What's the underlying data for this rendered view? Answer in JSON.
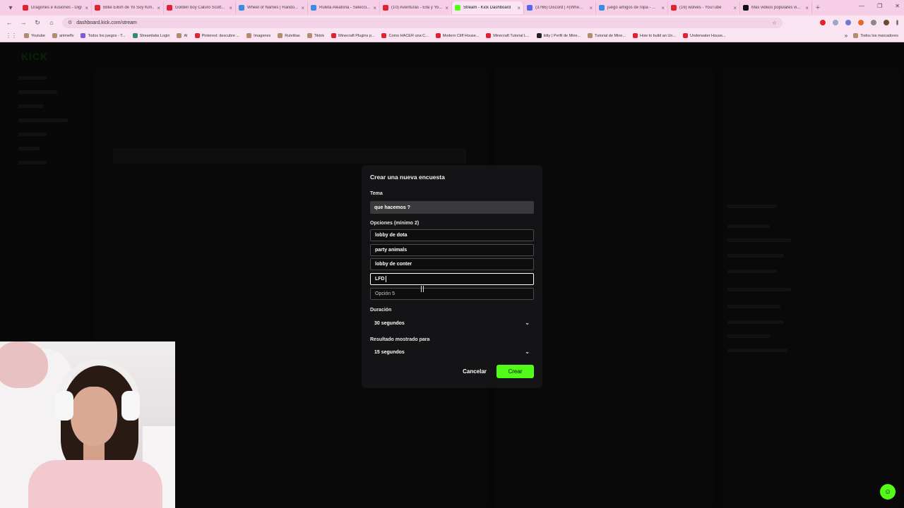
{
  "browser": {
    "tabs": [
      {
        "title": "Dragones e ilusiones - Digital...",
        "color": "#e0242f",
        "active": false
      },
      {
        "title": "Billie Eilish de Yo Soy Kim...",
        "color": "#e0242f",
        "active": false
      },
      {
        "title": "Golden boy Caluro Scott...",
        "color": "#e0242f",
        "active": false
      },
      {
        "title": "Wheel of Names | Rando...",
        "color": "#3b8be3",
        "active": false
      },
      {
        "title": "Ruleta Aleatoria - Selecci...",
        "color": "#3b8be3",
        "active": false
      },
      {
        "title": "(10) Aventuras - Ella y Yo...",
        "color": "#e0242f",
        "active": false
      },
      {
        "title": "Stream - Kick Dashboard",
        "color": "#53fc18",
        "active": true
      },
      {
        "title": "(3766) Discord | #(Whe...",
        "color": "#5865f2",
        "active": false
      },
      {
        "title": "juego amigos de ropa - ...",
        "color": "#3b8be3",
        "active": false
      },
      {
        "title": "(16) wolves - YouTube",
        "color": "#e0242f",
        "active": false
      },
      {
        "title": "Mas videos populares vi...",
        "color": "#111111",
        "active": false
      }
    ],
    "url": "dashboard.kick.com/stream",
    "bookmarks": [
      {
        "label": "Youtube",
        "color": "#b38b6d"
      },
      {
        "label": "animeflv",
        "color": "#b38b6d"
      },
      {
        "label": "Todos los juegos - T...",
        "color": "#7b5cd6"
      },
      {
        "label": "Streamlabs Login",
        "color": "#2a8f6a"
      },
      {
        "label": "AI",
        "color": "#b38b6d"
      },
      {
        "label": "Pinterest: descubre ...",
        "color": "#e0242f"
      },
      {
        "label": "Imagenes",
        "color": "#b38b6d"
      },
      {
        "label": "Ruletitas",
        "color": "#b38b6d"
      },
      {
        "label": "Tiktok",
        "color": "#b38b6d"
      },
      {
        "label": "Minecraft Plugins p...",
        "color": "#e0242f"
      },
      {
        "label": "Como HACER una C...",
        "color": "#e0242f"
      },
      {
        "label": "Modern Cliff House...",
        "color": "#e0242f"
      },
      {
        "label": "Minecraft Tutorial L...",
        "color": "#e0242f"
      },
      {
        "label": "kitty | Perfil de Mine...",
        "color": "#222222"
      },
      {
        "label": "Tutorial de Mine...",
        "color": "#b38b6d"
      },
      {
        "label": "How to build an Un...",
        "color": "#e0242f"
      },
      {
        "label": "Underwater House...",
        "color": "#e0242f"
      }
    ],
    "bookmarks_all": "Todos los marcadores"
  },
  "modal": {
    "title": "Crear una nueva encuesta",
    "topic_label": "Tema",
    "topic_value": "que hacemos ?",
    "options_label": "Opciones (mínimo 2)",
    "options": [
      {
        "value": "lobby de dota",
        "state": "filled"
      },
      {
        "value": "party animals",
        "state": "filled"
      },
      {
        "value": "lobby de conter",
        "state": "filled"
      },
      {
        "value": "LFD",
        "state": "focused"
      }
    ],
    "option_placeholder": "Opción 5",
    "duration_label": "Duración",
    "duration_value": "30 segundos",
    "result_label": "Resultado mostrado para",
    "result_value": "15 segundos",
    "cancel_label": "Cancelar",
    "create_label": "Crear",
    "accent_color": "#53fc18"
  }
}
